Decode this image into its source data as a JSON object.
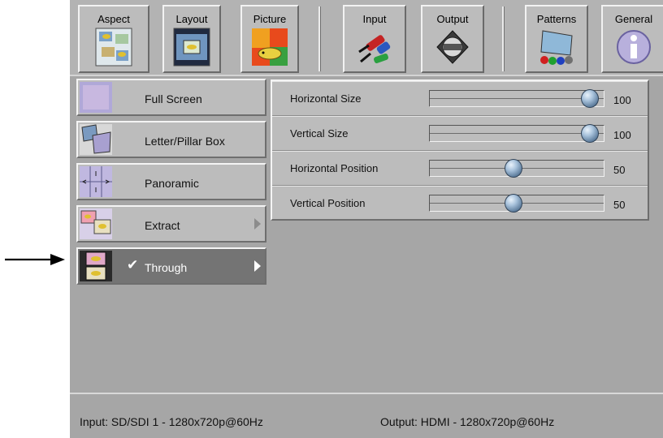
{
  "tabs": [
    {
      "label": "Aspect",
      "icon": "aspect-icon"
    },
    {
      "label": "Layout",
      "icon": "layout-icon"
    },
    {
      "label": "Picture",
      "icon": "picture-icon"
    },
    {
      "label": "Input",
      "icon": "input-icon"
    },
    {
      "label": "Output",
      "icon": "output-icon"
    },
    {
      "label": "Patterns",
      "icon": "patterns-icon"
    },
    {
      "label": "General",
      "icon": "general-info-icon"
    }
  ],
  "menu": {
    "items": [
      {
        "label": "Full Screen",
        "icon": "full-screen-thumb-icon",
        "selected": false,
        "has_submenu": false
      },
      {
        "label": "Letter/Pillar Box",
        "icon": "letter-pillar-box-thumb-icon",
        "selected": false,
        "has_submenu": false
      },
      {
        "label": "Panoramic",
        "icon": "panoramic-thumb-icon",
        "selected": false,
        "has_submenu": false
      },
      {
        "label": "Extract",
        "icon": "extract-thumb-icon",
        "selected": false,
        "has_submenu": true
      },
      {
        "label": "Through",
        "icon": "through-thumb-icon",
        "selected": true,
        "has_submenu": true,
        "check": "✔"
      }
    ]
  },
  "settings": {
    "rows": [
      {
        "label": "Horizontal Size",
        "value": "100",
        "level": 0.92
      },
      {
        "label": "Vertical Size",
        "value": "100",
        "level": 0.92
      },
      {
        "label": "Horizontal Position",
        "value": "50",
        "level": 0.48
      },
      {
        "label": "Vertical Position",
        "value": "50",
        "level": 0.48
      }
    ]
  },
  "status": {
    "input": "Input:   SD/SDI 1 - 1280x720p@60Hz",
    "output": "Output: HDMI - 1280x720p@60Hz"
  },
  "colors": {
    "screen_bg": "#a6a6a6",
    "button_bg": "#bcbcbc",
    "selected_bg": "#747474",
    "knob": "#7f9ebd"
  }
}
